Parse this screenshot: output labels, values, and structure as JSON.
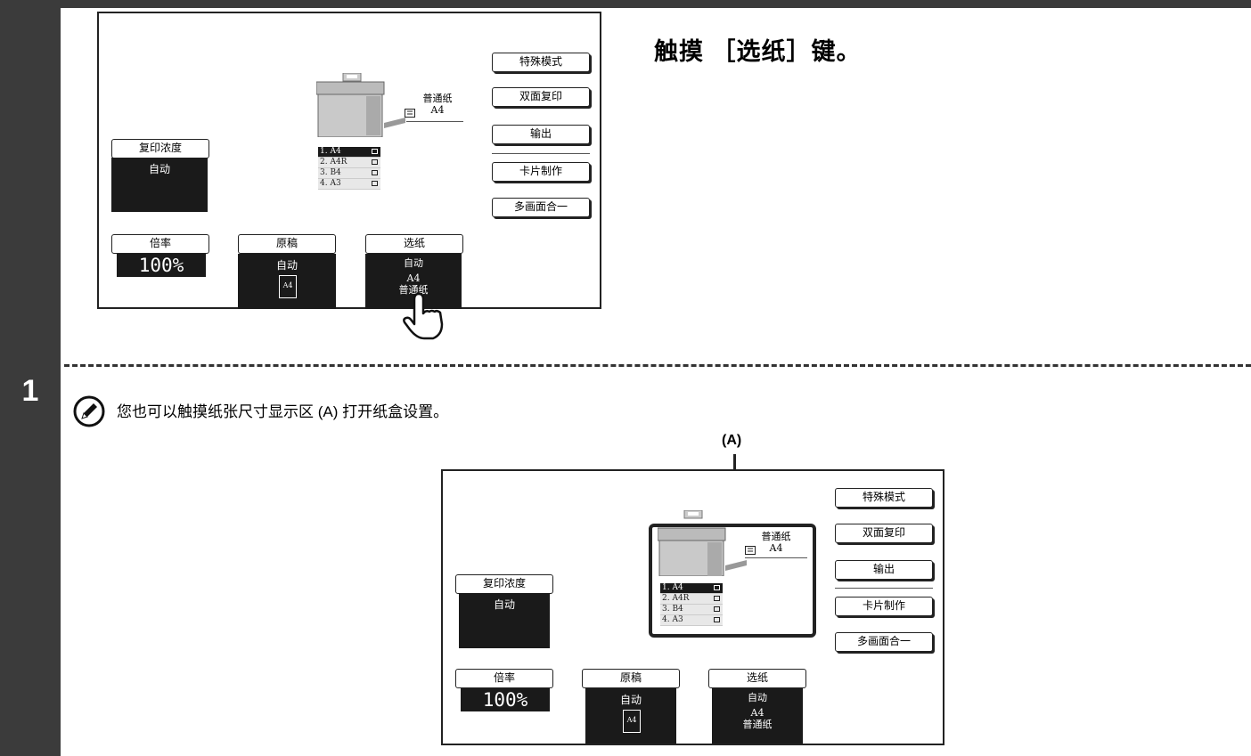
{
  "step": {
    "number": "1"
  },
  "instruction": {
    "heading": "触摸 ［选纸］键。"
  },
  "note": {
    "text": "您也可以触摸纸张尺寸显示区 (A) 打开纸盒设置。",
    "callout_label": "(A)"
  },
  "screen": {
    "right_buttons": [
      "特殊模式",
      "双面复印",
      "输出",
      "卡片制作",
      "多画面合一"
    ],
    "paper_type": "普通纸",
    "paper_size": "A4",
    "trays": [
      {
        "label": "1.  A4"
      },
      {
        "label": "2.  A4R"
      },
      {
        "label": "3.  B4"
      },
      {
        "label": "4.  A3"
      }
    ],
    "exposure": {
      "label": "复印浓度",
      "value": "自动"
    },
    "ratio": {
      "label": "倍率",
      "value": "100%"
    },
    "original": {
      "label": "原稿",
      "value": "自动",
      "size": "A4"
    },
    "paper_select": {
      "label": "选纸",
      "mode": "自动",
      "size": "A4",
      "type": "普通纸"
    }
  },
  "colors": {
    "sidebar": "#3b3b3b",
    "display_dark": "#1a1a1a"
  }
}
